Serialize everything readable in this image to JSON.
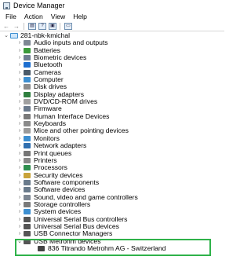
{
  "window": {
    "title": "Device Manager"
  },
  "menu": {
    "file": "File",
    "action": "Action",
    "view": "View",
    "help": "Help"
  },
  "toolbar": [
    {
      "name": "back-icon",
      "glyph": "←"
    },
    {
      "name": "forward-icon",
      "glyph": "→"
    },
    {
      "name": "properties-icon",
      "glyph": "▤"
    },
    {
      "name": "help-icon",
      "glyph": "?"
    },
    {
      "name": "update-driver-icon",
      "glyph": "▣"
    },
    {
      "name": "monitor-icon",
      "glyph": "▭"
    }
  ],
  "tree": {
    "root": {
      "label": "281-nbk-kmichal",
      "expanded": true
    },
    "categories": [
      {
        "label": "Audio inputs and outputs",
        "icon": "speaker-icon",
        "color": "#7d8793",
        "expanded": false
      },
      {
        "label": "Batteries",
        "icon": "battery-icon",
        "color": "#3b9b3b",
        "expanded": false
      },
      {
        "label": "Biometric devices",
        "icon": "fingerprint-icon",
        "color": "#6e7e91",
        "expanded": false
      },
      {
        "label": "Bluetooth",
        "icon": "bluetooth-icon",
        "color": "#1e6fd0",
        "expanded": false
      },
      {
        "label": "Cameras",
        "icon": "camera-icon",
        "color": "#4a5a6a",
        "expanded": false
      },
      {
        "label": "Computer",
        "icon": "computer-icon",
        "color": "#3d8fd1",
        "expanded": false
      },
      {
        "label": "Disk drives",
        "icon": "disk-drive-icon",
        "color": "#8c8c8c",
        "expanded": false
      },
      {
        "label": "Display adapters",
        "icon": "display-adapter-icon",
        "color": "#2f7f3f",
        "expanded": false
      },
      {
        "label": "DVD/CD-ROM drives",
        "icon": "dvd-drive-icon",
        "color": "#a0a0a0",
        "expanded": false
      },
      {
        "label": "Firmware",
        "icon": "firmware-icon",
        "color": "#6b7a8c",
        "expanded": false
      },
      {
        "label": "Human Interface Devices",
        "icon": "hid-icon",
        "color": "#7a7a7a",
        "expanded": false
      },
      {
        "label": "Keyboards",
        "icon": "keyboard-icon",
        "color": "#8a8a8a",
        "expanded": false
      },
      {
        "label": "Mice and other pointing devices",
        "icon": "mouse-icon",
        "color": "#9a9a9a",
        "expanded": false
      },
      {
        "label": "Monitors",
        "icon": "monitor-icon",
        "color": "#3d8fd1",
        "expanded": false
      },
      {
        "label": "Network adapters",
        "icon": "network-adapter-icon",
        "color": "#2f6fb0",
        "expanded": false
      },
      {
        "label": "Print queues",
        "icon": "print-queue-icon",
        "color": "#777777",
        "expanded": false
      },
      {
        "label": "Printers",
        "icon": "printer-icon",
        "color": "#888888",
        "expanded": false
      },
      {
        "label": "Processors",
        "icon": "processor-icon",
        "color": "#2f8f4f",
        "expanded": false
      },
      {
        "label": "Security devices",
        "icon": "security-device-icon",
        "color": "#c8a33a",
        "expanded": false
      },
      {
        "label": "Software components",
        "icon": "software-component-icon",
        "color": "#6a7b8c",
        "expanded": false
      },
      {
        "label": "Software devices",
        "icon": "software-device-icon",
        "color": "#6a7b8c",
        "expanded": false
      },
      {
        "label": "Sound, video and game controllers",
        "icon": "sound-icon",
        "color": "#7d8793",
        "expanded": false
      },
      {
        "label": "Storage controllers",
        "icon": "storage-controller-icon",
        "color": "#7a7a7a",
        "expanded": false
      },
      {
        "label": "System devices",
        "icon": "system-device-icon",
        "color": "#3d8fd1",
        "expanded": false
      },
      {
        "label": "Universal Serial Bus controllers",
        "icon": "usb-controller-icon",
        "color": "#555555",
        "expanded": false
      },
      {
        "label": "Universal Serial Bus devices",
        "icon": "usb-device-icon",
        "color": "#555555",
        "expanded": false
      },
      {
        "label": "USB Connector Managers",
        "icon": "usb-connector-icon",
        "color": "#555555",
        "expanded": false
      },
      {
        "label": "USB Metrohm devices",
        "icon": "usb-metrohm-icon",
        "color": "#555555",
        "expanded": true
      },
      {
        "label": "836 Titrando Metrohm AG - Switzerland",
        "icon": "usb-plug-icon",
        "color": "#444444",
        "child": true
      }
    ]
  },
  "highlight_color": "#2fb24a"
}
